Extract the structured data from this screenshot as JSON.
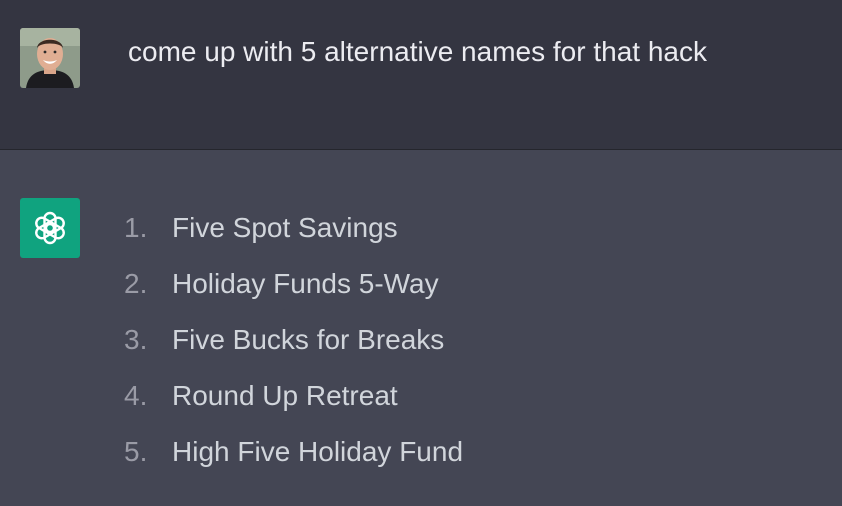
{
  "conversation": {
    "user_message": {
      "avatar_icon": "user-avatar-photo",
      "text": "come up with 5 alternative names for that hack"
    },
    "assistant_message": {
      "icon": "openai-logo-icon",
      "icon_bg": "#10a37f",
      "items": [
        {
          "num": "1.",
          "text": "Five Spot Savings"
        },
        {
          "num": "2.",
          "text": "Holiday Funds 5-Way"
        },
        {
          "num": "3.",
          "text": "Five Bucks for Breaks"
        },
        {
          "num": "4.",
          "text": "Round Up Retreat"
        },
        {
          "num": "5.",
          "text": "High Five Holiday Fund"
        }
      ]
    }
  }
}
